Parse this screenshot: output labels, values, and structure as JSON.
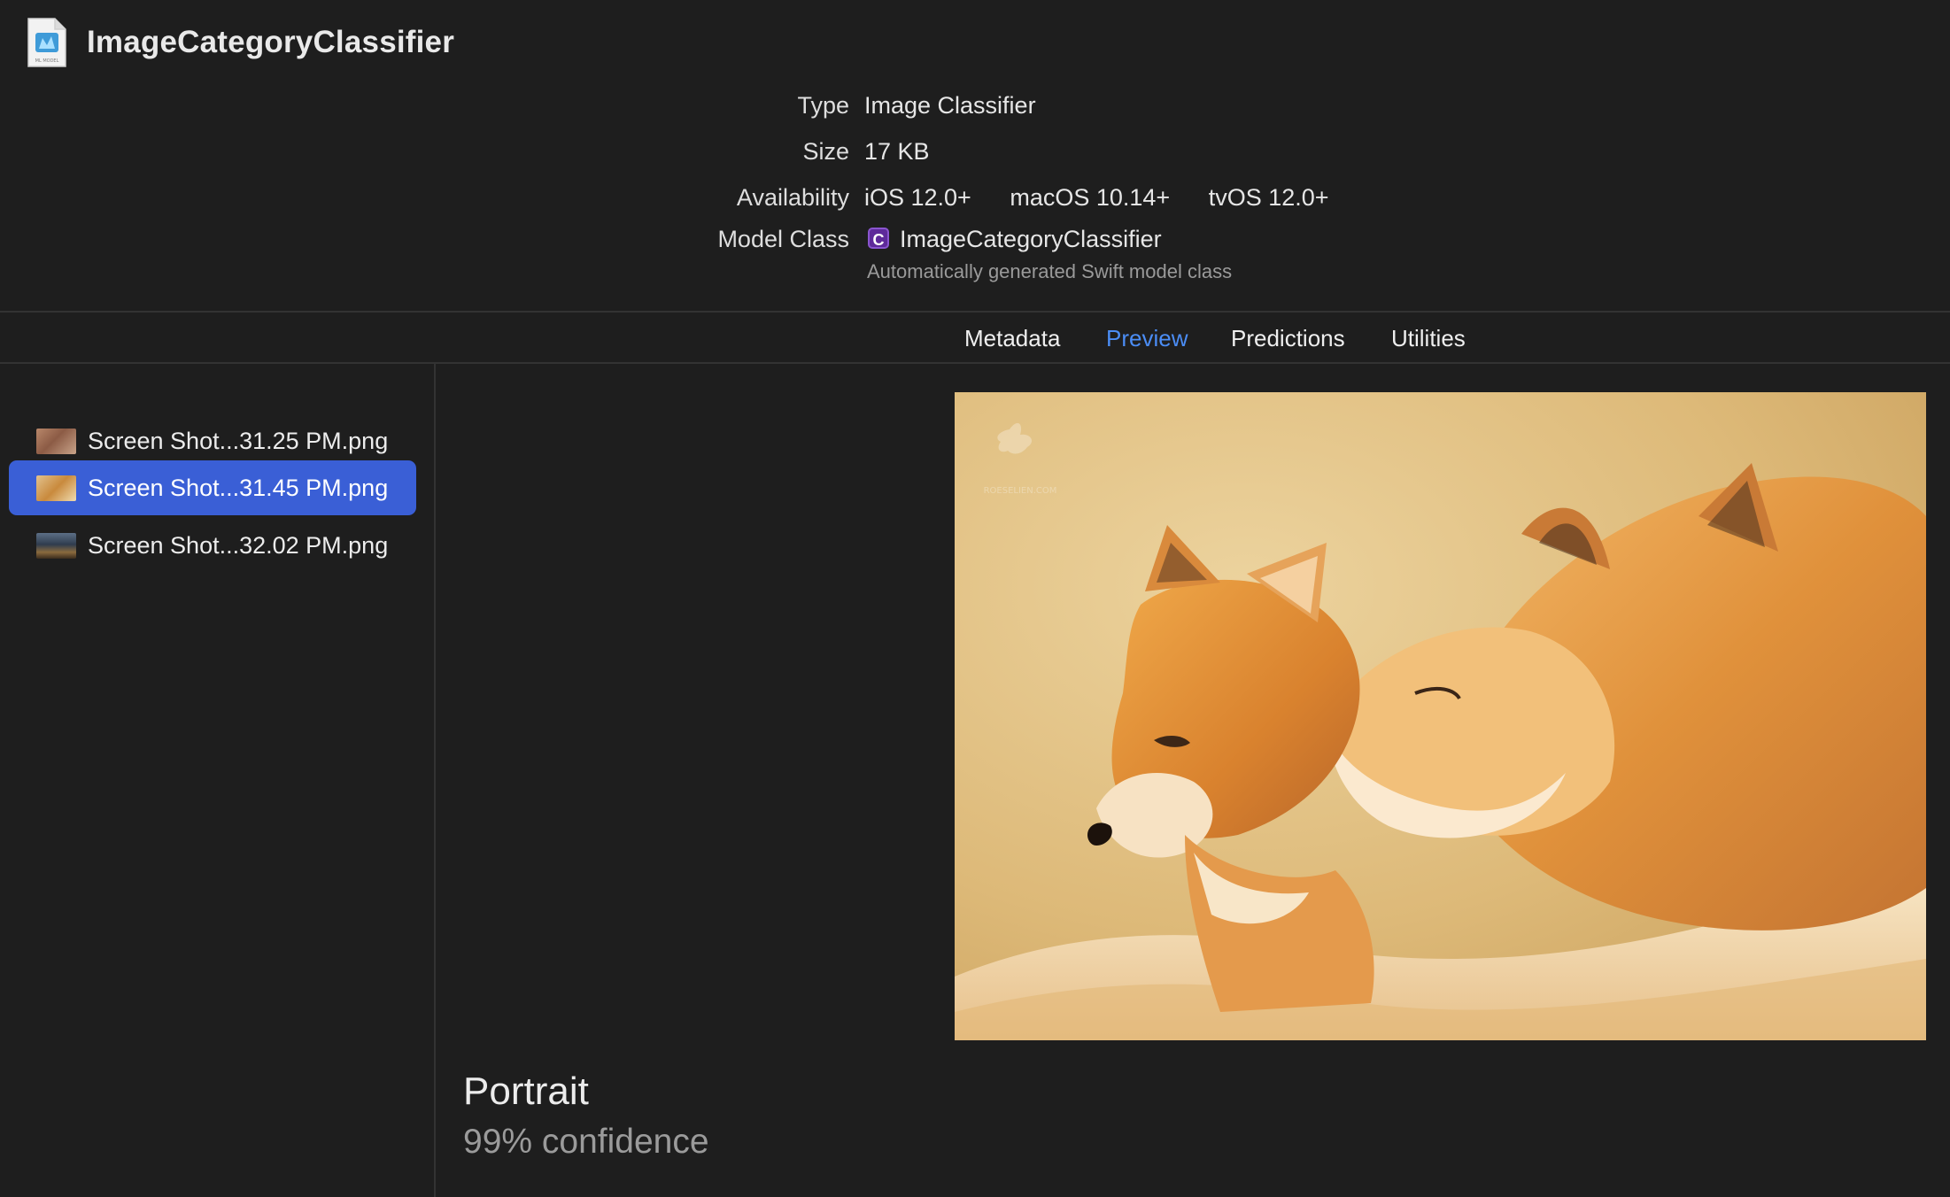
{
  "app": {
    "title": "ImageCategoryClassifier",
    "file_icon_label": "ML MODEL"
  },
  "info": {
    "type_label": "Type",
    "type_value": "Image Classifier",
    "size_label": "Size",
    "size_value": "17 KB",
    "availability_label": "Availability",
    "availability": [
      "iOS 12.0+",
      "macOS 10.14+",
      "tvOS 12.0+"
    ],
    "model_class_label": "Model Class",
    "model_class_badge": "C",
    "model_class_value": "ImageCategoryClassifier",
    "model_class_sub": "Automatically generated Swift model class"
  },
  "tabs": [
    {
      "label": "Metadata",
      "active": false
    },
    {
      "label": "Preview",
      "active": true
    },
    {
      "label": "Predictions",
      "active": false
    },
    {
      "label": "Utilities",
      "active": false
    }
  ],
  "files": [
    {
      "label": "Screen Shot...31.25 PM.png",
      "selected": false
    },
    {
      "label": "Screen Shot...31.45 PM.png",
      "selected": true
    },
    {
      "label": "Screen Shot...32.02 PM.png",
      "selected": false
    }
  ],
  "preview": {
    "watermark": "ROESELIEN.COM",
    "subject": "two red foxes nuzzling"
  },
  "result": {
    "class_label": "Portrait",
    "confidence": "99% confidence"
  },
  "colors": {
    "background": "#1e1e1e",
    "accent": "#4b8df5",
    "selection": "#3a5fd6",
    "class_badge": "#5e2a9a"
  }
}
